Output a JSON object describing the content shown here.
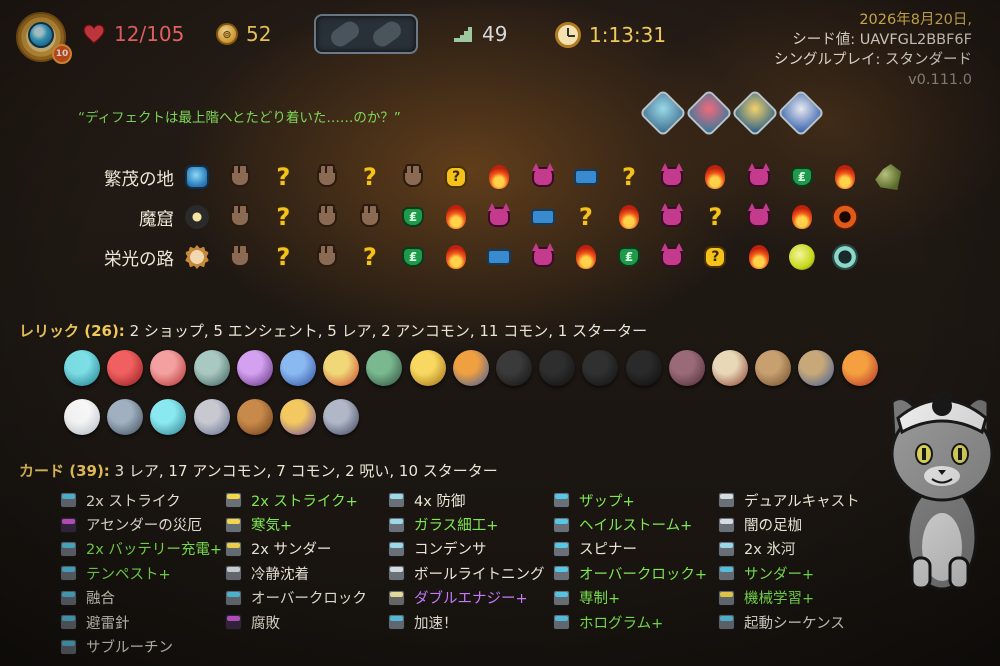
{
  "character": {
    "ascension": "10",
    "icon": "defect-orb-icon"
  },
  "stats": {
    "hp": "12/105",
    "gold": "52",
    "floor": "49",
    "time": "1:13:31"
  },
  "run_info": {
    "date": "2026年8月20日,",
    "seed": "シード値: UAVFGL2BBF6F",
    "mode": "シングルプレイ: スタンダード",
    "version": "v0.111.0"
  },
  "quote": "“ディフェクトは最上階へとたどり着いた……のか？”",
  "ancient_choices": [
    "axe-relic-icon",
    "heart-relic-icon",
    "chest-relic-icon",
    "eye-relic-icon"
  ],
  "acts": [
    {
      "name": "繁茂の地",
      "nodes": [
        "start1",
        "monster",
        "unknown",
        "monster",
        "unknown",
        "monster",
        "bagunknown",
        "rest",
        "elite",
        "treasure",
        "unknown",
        "elite",
        "rest",
        "elite",
        "shop",
        "rest",
        "boss1"
      ]
    },
    {
      "name": "魔窟",
      "nodes": [
        "start2",
        "monster",
        "unknown",
        "monster",
        "monster",
        "shop",
        "rest",
        "elite",
        "treasure",
        "unknown",
        "rest",
        "elite",
        "unknown",
        "elite",
        "rest",
        "boss2"
      ]
    },
    {
      "name": "栄光の路",
      "nodes": [
        "start3",
        "monster",
        "unknown",
        "monster",
        "unknown",
        "shop",
        "rest",
        "treasure",
        "elite",
        "rest",
        "shop",
        "elite",
        "bagunknown",
        "rest",
        "boss3",
        "boss4"
      ]
    }
  ],
  "relics": {
    "label": "レリック (26):",
    "summary": " 2 ショップ,  5 エンシェント,  5 レア,  2 アンコモン,  11 コモン,  1 スターター",
    "items": [
      {
        "name": "cracked-core-icon",
        "c1": "#7ee0e8",
        "c2": "#1a7a88"
      },
      {
        "name": "dice-icon",
        "c1": "#f06060",
        "c2": "#8a1a1a"
      },
      {
        "name": "red-mask-icon",
        "c1": "#f4a0a0",
        "c2": "#b02a2a"
      },
      {
        "name": "gremlin-jar-icon",
        "c1": "#a8c8c0",
        "c2": "#3a5a58"
      },
      {
        "name": "purple-eye-icon",
        "c1": "#d4a0f0",
        "c2": "#5a2a7a"
      },
      {
        "name": "feather-icon",
        "c1": "#8ab8f0",
        "c2": "#2a4a9a"
      },
      {
        "name": "candy-icon",
        "c1": "#f0d878",
        "c2": "#c8402a"
      },
      {
        "name": "teapot-icon",
        "c1": "#7ab890",
        "c2": "#2a4a38"
      },
      {
        "name": "golden-disc-icon",
        "c1": "#f8d860",
        "c2": "#9a6a10"
      },
      {
        "name": "lantern-box-icon",
        "c1": "#f0a040",
        "c2": "#3a5aa0"
      },
      {
        "name": "old-coin-icon",
        "c1": "#3a3a3a",
        "c2": "#111111"
      },
      {
        "name": "dark-brick-icon",
        "c1": "#2e2e2e",
        "c2": "#0e0e0e"
      },
      {
        "name": "dark-ticket-icon",
        "c1": "#303030",
        "c2": "#101010"
      },
      {
        "name": "dark-swirl-icon",
        "c1": "#2a2a2a",
        "c2": "#0c0c0c"
      },
      {
        "name": "book-icon",
        "c1": "#9a6a78",
        "c2": "#4a2a34"
      },
      {
        "name": "tent-icon",
        "c1": "#e8d8b8",
        "c2": "#8a3a2a"
      },
      {
        "name": "backpack-icon",
        "c1": "#c8a070",
        "c2": "#6a4a28"
      },
      {
        "name": "acorn-icon",
        "c1": "#c8a878",
        "c2": "#3a5a9a"
      },
      {
        "name": "cannon-icon",
        "c1": "#f4a040",
        "c2": "#b02a2a"
      },
      {
        "name": "white-flower-icon",
        "c1": "#ffffff",
        "c2": "#b8c0c8"
      },
      {
        "name": "trident-icon",
        "c1": "#a0b0c0",
        "c2": "#3a4a58"
      },
      {
        "name": "prism-icon",
        "c1": "#8ae8f0",
        "c2": "#2a7a8a"
      },
      {
        "name": "shield-cloth-icon",
        "c1": "#c8c8d0",
        "c2": "#5a6a8a"
      },
      {
        "name": "wooden-totem-icon",
        "c1": "#c88a4a",
        "c2": "#6a3a18"
      },
      {
        "name": "orrery-icon",
        "c1": "#f4c860",
        "c2": "#6a4aa0"
      },
      {
        "name": "kunai-icon",
        "c1": "#b0b8c8",
        "c2": "#3a3e58"
      }
    ]
  },
  "cards": {
    "label": "カード (39):",
    "summary": " 3 レア,  17 アンコモン,  7 コモン,  2 呪い,  10 スターター",
    "columns": [
      [
        {
          "name": "2x ストライク",
          "type": "attack",
          "style": ""
        },
        {
          "name": "アセンダーの災厄",
          "type": "curse",
          "style": ""
        },
        {
          "name": "2x バッテリー充電+",
          "type": "skill",
          "style": "up"
        },
        {
          "name": "テンペスト+",
          "type": "skill",
          "style": "up"
        },
        {
          "name": "融合",
          "type": "skill",
          "style": ""
        },
        {
          "name": "避雷針",
          "type": "skill",
          "style": ""
        },
        {
          "name": "サブルーチン",
          "type": "power",
          "style": ""
        }
      ],
      [
        {
          "name": "2x ストライク+",
          "type": "rare",
          "style": "up"
        },
        {
          "name": "寒気+",
          "type": "rare",
          "style": "up"
        },
        {
          "name": "2x サンダー",
          "type": "rare",
          "style": ""
        },
        {
          "name": "冷静沈着",
          "type": "status",
          "style": ""
        },
        {
          "name": "オーバークロック",
          "type": "skill",
          "style": ""
        },
        {
          "name": "腐敗",
          "type": "curse",
          "style": ""
        }
      ],
      [
        {
          "name": "4x 防御",
          "type": "unc",
          "style": ""
        },
        {
          "name": "ガラス細工+",
          "type": "unc",
          "style": "up"
        },
        {
          "name": "コンデンサ",
          "type": "unc",
          "style": ""
        },
        {
          "name": "ボールライトニング",
          "type": "status",
          "style": ""
        },
        {
          "name": "ダブルエナジー+",
          "type": "colorless",
          "style": "purple"
        },
        {
          "name": "加速！",
          "type": "skill",
          "style": ""
        }
      ],
      [
        {
          "name": "ザップ+",
          "type": "skill",
          "style": "up"
        },
        {
          "name": "ヘイルストーム+",
          "type": "skill",
          "style": "up"
        },
        {
          "name": "スピナー",
          "type": "skill",
          "style": ""
        },
        {
          "name": "オーバークロック+",
          "type": "skill",
          "style": "up"
        },
        {
          "name": "専制+",
          "type": "skill",
          "style": "up"
        },
        {
          "name": "ホログラム+",
          "type": "skill",
          "style": "up"
        }
      ],
      [
        {
          "name": "デュアルキャスト",
          "type": "status",
          "style": ""
        },
        {
          "name": "闇の足枷",
          "type": "status",
          "style": ""
        },
        {
          "name": "2x 氷河",
          "type": "unc",
          "style": ""
        },
        {
          "name": "サンダー+",
          "type": "skill",
          "style": "up"
        },
        {
          "name": "機械学習+",
          "type": "rare",
          "style": "up"
        },
        {
          "name": "起動シーケンス",
          "type": "skill",
          "style": ""
        }
      ]
    ]
  }
}
